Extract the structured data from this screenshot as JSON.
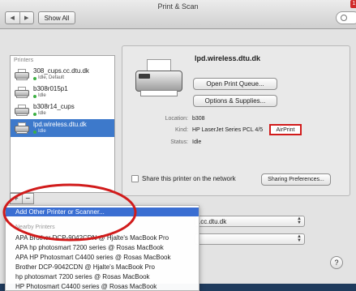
{
  "window": {
    "title": "Print & Scan",
    "show_all_label": "Show All",
    "search_badge": "1"
  },
  "printers": {
    "header": "Printers",
    "items": [
      {
        "name": "308_cups.cc.dtu.dk",
        "status": "Idle, Default",
        "selected": false
      },
      {
        "name": "b308r015p1",
        "status": "Idle",
        "selected": false
      },
      {
        "name": "b308r14_cups",
        "status": "Idle",
        "selected": false
      },
      {
        "name": "lpd.wireless.dtu.dk",
        "status": "Idle",
        "selected": true
      }
    ],
    "add_label": "+",
    "remove_label": "−"
  },
  "detail": {
    "printer_name": "lpd.wireless.dtu.dk",
    "open_queue_label": "Open Print Queue...",
    "options_label": "Options & Supplies...",
    "location_label": "Location:",
    "location_value": "b308",
    "kind_label": "Kind:",
    "kind_value": "HP LaserJet Series PCL 4/5",
    "airprint_label": "AirPrint",
    "status_label": "Status:",
    "status_value": "Idle",
    "share_label": "Share this printer on the network",
    "sharing_prefs_label": "Sharing Preferences..."
  },
  "lower": {
    "default_printer_value": ".cc.dtu.dk",
    "paper_size_value": "",
    "help_label": "?"
  },
  "menu": {
    "add_other_label": "Add Other Printer or Scanner...",
    "section_label": "Nearby Printers",
    "items": [
      "APA Brother DCP-9042CDN @ Hjalte's MacBook Pro",
      "APA hp photosmart 7200 series @ Rosas MacBook",
      "APA HP Photosmart C4400 series @ Rosas MacBook",
      "Brother DCP-9042CDN @ Hjalte's MacBook Pro",
      "hp photosmart 7200 series @ Rosas MacBook",
      "HP Photosmart C4400 series @ Rosas MacBook"
    ]
  },
  "colors": {
    "selection": "#3d79cb",
    "annotation_red": "#d11b1b",
    "menu_highlight": "#3a6ed2"
  }
}
